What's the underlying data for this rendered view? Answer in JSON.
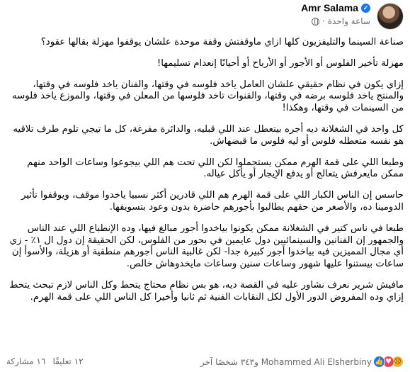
{
  "post": {
    "author": "Amr Salama",
    "timestamp": "ساعة واحدة",
    "separator": "·",
    "paragraphs": [
      "صناعة السينما والتليفزيون كلها ازاي ماوقفتش وقفة موحدة علشان يوقفوا مهزلة بقالها عقود؟",
      "مهزلة تأخير الفلوس أو الأجور أو الأرباح أو أحيانًا إنعدام تسليمها!",
      "إزاي يكون في نظام حقيقي علشان العامل ياخد فلوسه في وقتها، والفنان ياخد فلوسه في وقتها، والمنتج ياخد فلوسه برضه في وقتها، والقنوات تاخد فلوسها من المعلن في وقتها، والموزع ياخد فلوسه من السينمات في وقتها، وهكذا!",
      "كل واحد في الشغلانة ديه أجره بيتعطل عند اللي قبليه، والدائرة مفرغة، كل ما تيجي تلوم طرف تلاقيه هو نفسه متعطله فلوس أو ليه فلوس ما قبضهاش.",
      "وطبعا اللي على قمة الهرم ممكن يستحملوا لكن اللي تحت هم اللي بيجوعوا وساعات الواحد منهم ممكن مايعرفش يتعالج أو يدفع الإيجار أو يأكل عياله.",
      "حاسس إن الناس الكبار اللي على قمة الهرم هم اللي قادرين أكثر نسبيا ياخدوا موقف، ويوقفوا تأثير الدومينا ده، والأصغر من حقهم يطالبوا بأجورهم حاضرة بدون وعود بتسويفها.",
      "طبعا في ناس كتير في الشغلانة ممكن يكونوا بياخدوا أجور مبالغ فيها، وده الإنطباع اللي عند الناس والجمهور إن الفنانين والسينمائيين دول عايمين في بحور من الفلوس، لكن الحقيقة إن دول ال ١٪ - زي أي مجال المميزين فيه بياخدوا أجور كبيرة جدا- لكن غالبية الناس أجورهم منطقية أو هزيلة، والأسوأ إن ساعات بيستنوا عليها شهور وساعات سنين وساعات مايخدوهاش خالص.",
      "مافيش شرير نعرف نشاور عليه في القصة ديه، هو بس نظام محتاج يتحط وكل الناس لازم تبحث يتحط إزاي وده المفروض الدور الأول لكل النقابات الفنية ثم ثانيا وأخيرا كل الناس اللي على قمة الهرم."
    ]
  },
  "footer": {
    "reactions_text": "Mohammed Ali Elsherbiny و٣٤٣ شخصًا آخر",
    "comments": "١٢ تعليقًا",
    "shares": "١٦ مشاركة"
  }
}
